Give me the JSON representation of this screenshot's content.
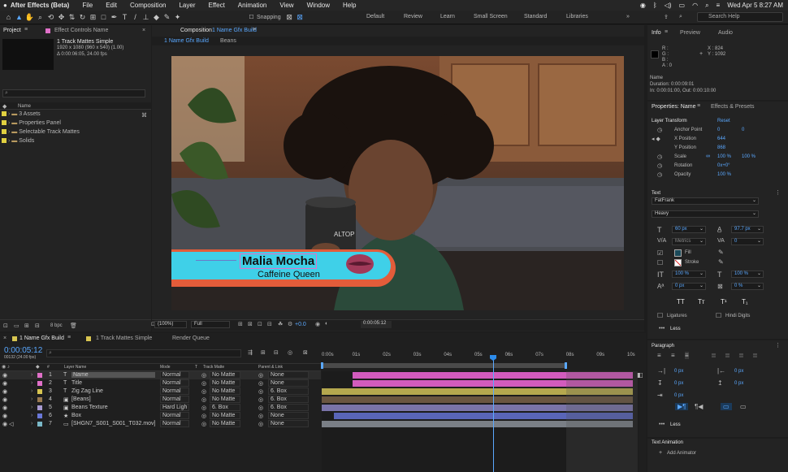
{
  "menubar": {
    "app": "After Effects (Beta)",
    "items": [
      "File",
      "Edit",
      "Composition",
      "Layer",
      "Effect",
      "Animation",
      "View",
      "Window",
      "Help"
    ],
    "clock": "Wed Apr 5  8:27 AM"
  },
  "toolbar": {
    "snapping": "Snapping",
    "workspaces": [
      "Default",
      "Review",
      "Learn",
      "Small Screen",
      "Standard",
      "Libraries"
    ],
    "search_placeholder": "Search Help"
  },
  "project": {
    "tab": "Project",
    "tab2": "Effect Controls Name",
    "item_name": "1 Track Mattes Simple",
    "item_res": "1920 x 1080  (960 x 540) (1.00)",
    "item_dur": "Δ 0:00:06:05, 24.00 fps",
    "col_name": "Name",
    "folders": [
      "3 Assets",
      "Properties Panel",
      "Selectable Track Mattes",
      "Solids"
    ],
    "bpc": "8 bpc"
  },
  "composition": {
    "tab_prefix": "Composition",
    "tab_name": "1 Name Gfx Build",
    "sub_tabs": [
      "1 Name Gfx Build",
      "Beans"
    ],
    "lower_third_name": "Malia Mocha",
    "lower_third_title": "Caffeine Queen",
    "cup_text": "ALTOP",
    "zoom": "(100%)",
    "resolution": "Full",
    "exposure": "+0.0",
    "timecode": "0:00:05:12"
  },
  "info": {
    "tabs": [
      "Info",
      "Preview",
      "Audio"
    ],
    "rgba": [
      "R :",
      "G :",
      "B :",
      "A : 0"
    ],
    "coords": [
      "X : 824",
      "Y : 1092"
    ],
    "name_label": "Name",
    "duration": "Duration: 0:00:09:01",
    "inout": "In: 0:00:01:00, Out: 0:00:10:00"
  },
  "properties": {
    "tab": "Properties: Name",
    "tab2": "Effects & Presets",
    "layer_transform": "Layer Transform",
    "reset": "Reset",
    "rows": [
      {
        "label": "Anchor Point",
        "v1": "0",
        "v2": "0"
      },
      {
        "label": "X Position",
        "v1": "644",
        "v2": ""
      },
      {
        "label": "Y Position",
        "v1": "868",
        "v2": ""
      },
      {
        "label": "Scale",
        "v1": "100 %",
        "v2": "100 %"
      },
      {
        "label": "Rotation",
        "v1": "0x+0°",
        "v2": ""
      },
      {
        "label": "Opacity",
        "v1": "100 %",
        "v2": ""
      }
    ],
    "text_label": "Text",
    "font": "FatFrank",
    "style": "Heavy",
    "font_size": "60 px",
    "leading": "97.7 px",
    "kerning": "Metrics",
    "tracking": "0",
    "fill": "Fill",
    "stroke": "Stroke",
    "vscale": "100 %",
    "hscale": "100 %",
    "baseline": "0 px",
    "tsume": "0 %",
    "caps": [
      "TT",
      "Tт",
      "T¹",
      "T₁"
    ],
    "ligatures": "Ligatures",
    "hindi": "Hindi Digits",
    "less": "Less",
    "paragraph": "Paragraph",
    "indents": [
      "0 px",
      "0 px",
      "0 px",
      "0 px",
      "0 px"
    ],
    "text_animation": "Text Animation",
    "add_animator": "Add Animator"
  },
  "timeline": {
    "tabs": [
      "1 Name Gfx Build",
      "1 Track Mattes Simple",
      "Render Queue"
    ],
    "timecode": "0:00:05:12",
    "fps": "00132 (24.00 fps)",
    "cols": [
      "#",
      "Layer Name",
      "Mode",
      "T",
      "Track Matte",
      "Parent & Link"
    ],
    "ruler": [
      "0:00s",
      "01s",
      "02s",
      "03s",
      "04s",
      "05s",
      "06s",
      "07s",
      "08s",
      "09s",
      "10s"
    ],
    "layers": [
      {
        "num": "1",
        "name": "Name",
        "mode": "Normal",
        "matte": "No Matte",
        "parent": "None",
        "color": "#e070c8",
        "bar": "#d25bbd",
        "start": 0.1,
        "end": 1.0
      },
      {
        "num": "2",
        "name": "Title",
        "mode": "Normal",
        "matte": "No Matte",
        "parent": "None",
        "color": "#e070c8",
        "bar": "#d25bbd",
        "start": 0.1,
        "end": 1.0
      },
      {
        "num": "3",
        "name": "Zig Zag Line",
        "mode": "Normal",
        "matte": "No Matte",
        "parent": "6. Box",
        "color": "#d8c550",
        "bar": "#b5a84e",
        "start": 0.0,
        "end": 1.0
      },
      {
        "num": "4",
        "name": "[Beans]",
        "mode": "Normal",
        "matte": "No Matte",
        "parent": "6. Box",
        "color": "#9a7a50",
        "bar": "#6a5640",
        "start": 0.0,
        "end": 1.0
      },
      {
        "num": "5",
        "name": "Beans Texture",
        "mode": "Hard Ligh",
        "matte": "6. Box",
        "parent": "6. Box",
        "color": "#a89ad0",
        "bar": "#7a74a8",
        "start": 0.0,
        "end": 1.0
      },
      {
        "num": "6",
        "name": "Box",
        "mode": "Normal",
        "matte": "No Matte",
        "parent": "None",
        "color": "#6a78d8",
        "bar": "#5965b8",
        "start": 0.04,
        "end": 1.0
      },
      {
        "num": "7",
        "name": "[SHGN7_S001_S001_T032.mov]",
        "mode": "Normal",
        "matte": "No Matte",
        "parent": "None",
        "color": "#7ab8c8",
        "bar": "#7a7f86",
        "start": 0.0,
        "end": 1.0
      }
    ]
  },
  "colors": {
    "accent": "#2d8ceb",
    "panel": "#232323",
    "lower_third_cyan": "#3fd0e8",
    "lower_third_orange": "#e35c3a"
  }
}
